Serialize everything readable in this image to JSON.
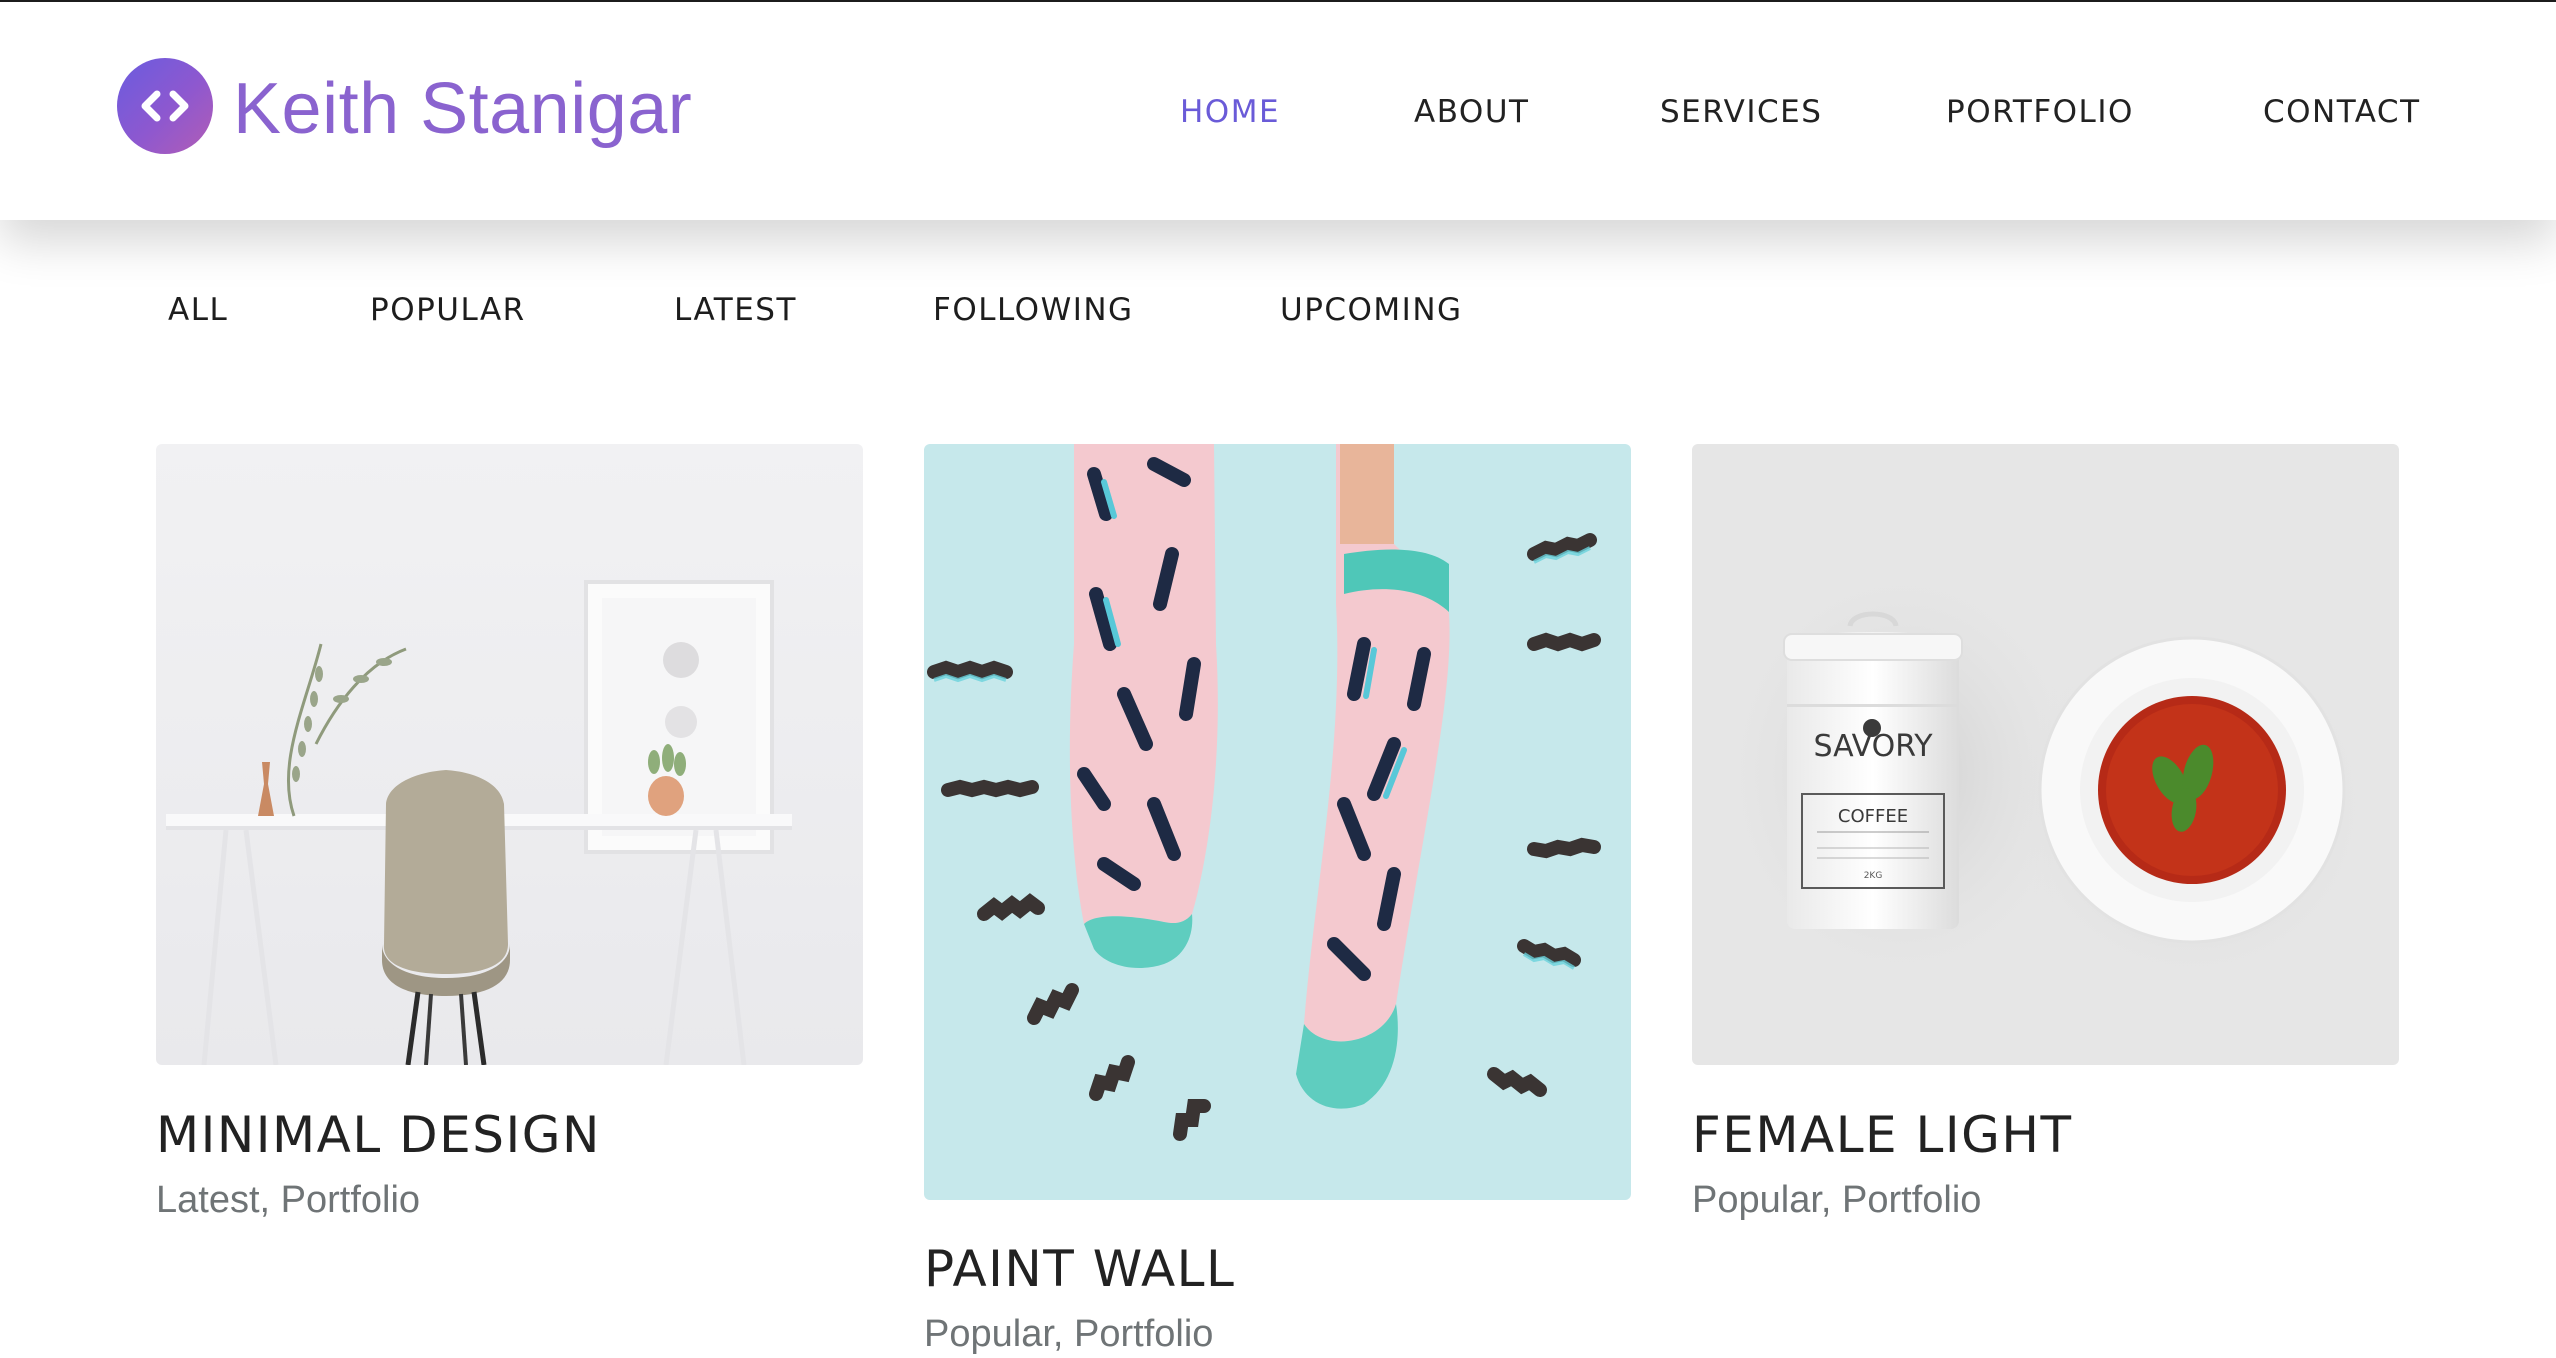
{
  "brand": {
    "name": "Keith Stanigar",
    "logo_icon": "code-brackets-icon",
    "gradient": [
      "#6a5cdf",
      "#b25db5"
    ]
  },
  "nav": {
    "items": [
      {
        "label": "HOME",
        "active": true
      },
      {
        "label": "ABOUT",
        "active": false
      },
      {
        "label": "SERVICES",
        "active": false
      },
      {
        "label": "PORTFOLIO",
        "active": false
      },
      {
        "label": "CONTACT",
        "active": false
      }
    ],
    "active_color": "#6a5bd8"
  },
  "filters": [
    "ALL",
    "POPULAR",
    "LATEST",
    "FOLLOWING",
    "UPCOMING"
  ],
  "cards": [
    {
      "title": "MINIMAL DESIGN",
      "tags": [
        "Latest",
        "Portfolio"
      ],
      "image": "desk-chair-photo"
    },
    {
      "title": "PAINT WALL",
      "tags": [
        "Popular",
        "Portfolio"
      ],
      "image": "patterned-socks-photo"
    },
    {
      "title": "FEMALE LIGHT",
      "tags": [
        "Popular",
        "Portfolio"
      ],
      "image": "coffee-tin-soup-photo"
    }
  ],
  "product": {
    "brand_label": "SAVORY",
    "product_label": "COFFEE",
    "weight_label": "2KG"
  }
}
